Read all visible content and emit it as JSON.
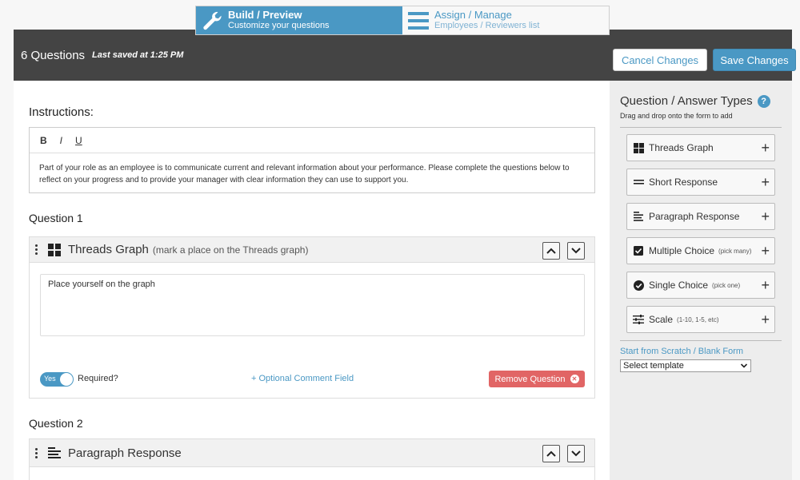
{
  "steps": [
    {
      "title": "Build / Preview",
      "subtitle": "Customize your questions"
    },
    {
      "title": "Assign / Manage",
      "subtitle": "Employees / Reviewers list"
    }
  ],
  "header": {
    "question_count": "6 Questions",
    "last_saved": "Last saved at 1:25 PM",
    "cancel_label": "Cancel Changes",
    "save_label": "Save Changes"
  },
  "instructions": {
    "label": "Instructions:",
    "toolbar": {
      "bold": "B",
      "italic": "I",
      "underline": "U"
    },
    "text": "Part of your role as an employee is to communicate current and relevant information about your performance. Please complete the questions below to reflect on your progress and to provide your manager with clear information they can use to support you."
  },
  "questions": [
    {
      "label": "Question 1",
      "type_name": "Threads Graph",
      "type_hint": "(mark a place on the Threads graph)",
      "prompt": "Place yourself on the graph",
      "toggle_label": "Yes",
      "required_label": "Required?",
      "optional_comment": "+ Optional Comment Field",
      "remove_label": "Remove Question"
    },
    {
      "label": "Question 2",
      "type_name": "Paragraph Response",
      "type_hint": ""
    }
  ],
  "sidebar": {
    "title": "Question / Answer Types",
    "help": "?",
    "subtitle": "Drag and drop onto the form to add",
    "types": [
      {
        "label": "Threads Graph",
        "hint": "",
        "icon": "grid-icon"
      },
      {
        "label": "Short Response",
        "hint": "",
        "icon": "short-lines-icon"
      },
      {
        "label": "Paragraph Response",
        "hint": "",
        "icon": "paragraph-icon"
      },
      {
        "label": "Multiple Choice",
        "hint": "(pick many)",
        "icon": "checkbox-icon"
      },
      {
        "label": "Single Choice",
        "hint": "(pick one)",
        "icon": "check-circle-icon"
      },
      {
        "label": "Scale",
        "hint": "(1-10, 1-5, etc)",
        "icon": "sliders-icon"
      }
    ],
    "plus": "+",
    "scratch_link": "Start from Scratch / Blank Form",
    "template_select": "Select template"
  },
  "colors": {
    "accent": "#4a98c4",
    "header_bg": "#444444",
    "danger": "#e16565"
  }
}
